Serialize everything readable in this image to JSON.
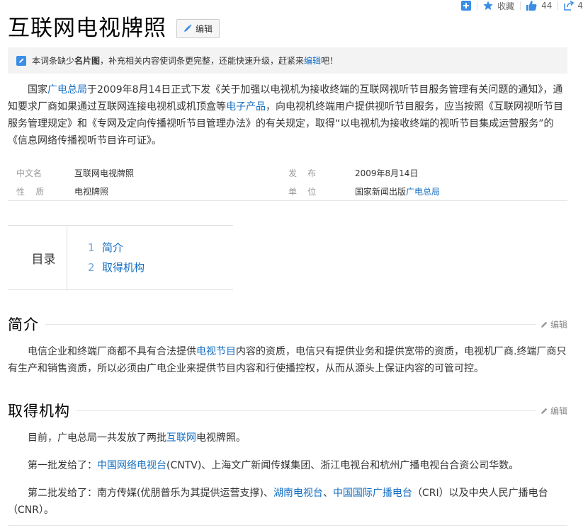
{
  "toolbar": {
    "favorite_label": "收藏",
    "like_count": "44",
    "share_count": "4"
  },
  "title": "互联网电视牌照",
  "edit_label": "编辑",
  "notice": {
    "pre": "本词条缺少",
    "bold": "名片图",
    "mid": "，补充相关内容使词条更完整，还能快速升级，赶紧来",
    "link": "编辑",
    "post": "吧！"
  },
  "intro": {
    "p1": "国家",
    "l1": "广电总局",
    "p2": "于2009年8月14日正式下发《关于加强以电视机为接收终端的互联网视听节目服务管理有关问题的通知》，通知要求厂商如果通过互联网连接电视机或机顶盒等",
    "l2": "电子产品",
    "p3": "，向电视机终端用户提供视听节目服务，应当按照《互联网视听节目服务管理规定》和《专网及定向传播视听节目管理办法》的有关规定，取得“以电视机为接收终端的视听节目集成运营服务”的《信息网络传播视听节目许可证》。"
  },
  "basic_info": {
    "rows": [
      {
        "k1": "中文名",
        "v1": "互联网电视牌照",
        "k2": "发    布",
        "v2": "2009年8月14日",
        "v2_link": ""
      },
      {
        "k1": "性    质",
        "v1": "电视牌照",
        "k2": "单    位",
        "v2": "国家新闻出版",
        "v2_link": "广电总局"
      }
    ]
  },
  "toc": {
    "label": "目录",
    "items": [
      {
        "num": "1",
        "label": "简介"
      },
      {
        "num": "2",
        "label": "取得机构"
      }
    ]
  },
  "sections": {
    "intro_heading": "简介",
    "intro_edit": "编辑",
    "intro_p1": "电信企业和终端厂商都不具有合法提供",
    "intro_l1": "电视节目",
    "intro_p2": "内容的资质，电信只有提供业务和提供宽带的资质，电视机厂商.终端厂商只有生产和销售资质，所以必须由广电企业来提供节目内容和行使播控权，从而从源头上保证内容的可管可控。",
    "org_heading": "取得机构",
    "org_edit": "编辑",
    "org_p1a": "目前，广电总局一共发放了两批",
    "org_p1l": "互联网",
    "org_p1b": "电视牌照。",
    "org_p2a": "第一批发给了：",
    "org_p2l": "中国网络电视台",
    "org_p2b": "(CNTV)、上海文广新闻传媒集团、浙江电视台和杭州广播电视台合资公司华数。",
    "org_p3a": "第二批发给了：南方传媒(优朋普乐为其提供运营支撑)、",
    "org_p3l1": "湖南电视台",
    "org_p3s": "、",
    "org_p3l2": "中国国际广播电台",
    "org_p3b": "（CRI）以及中央人民广播电台（CNR）。"
  }
}
